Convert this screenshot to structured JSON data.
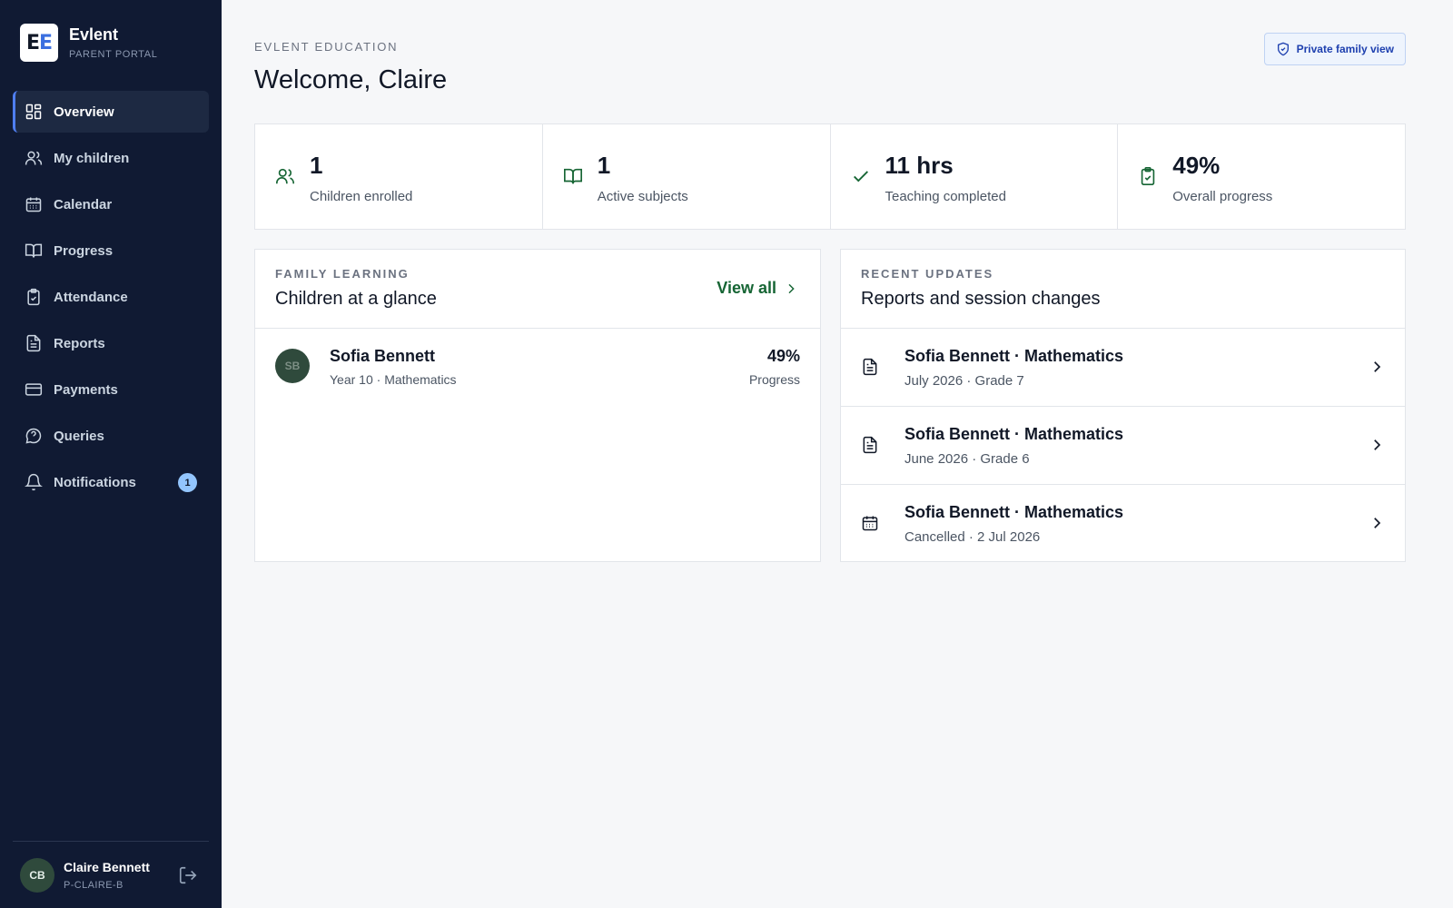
{
  "brand": {
    "logo_left": "E",
    "logo_right": "E",
    "name": "Evlent",
    "subtitle": "PARENT PORTAL"
  },
  "nav": {
    "items": [
      {
        "label": "Overview",
        "icon": "grid-icon",
        "active": true
      },
      {
        "label": "My children",
        "icon": "users-icon"
      },
      {
        "label": "Calendar",
        "icon": "calendar-icon"
      },
      {
        "label": "Progress",
        "icon": "book-icon"
      },
      {
        "label": "Attendance",
        "icon": "clipboard-check-icon"
      },
      {
        "label": "Reports",
        "icon": "document-icon"
      },
      {
        "label": "Payments",
        "icon": "credit-card-icon"
      },
      {
        "label": "Queries",
        "icon": "help-circle-icon"
      },
      {
        "label": "Notifications",
        "icon": "bell-icon",
        "badge": "1"
      }
    ]
  },
  "user": {
    "initials": "CB",
    "name": "Claire Bennett",
    "id": "P-CLAIRE-B"
  },
  "header": {
    "kicker": "EVLENT EDUCATION",
    "title": "Welcome, Claire",
    "private_label": "Private family view"
  },
  "stats": [
    {
      "value": "1",
      "label": "Children enrolled",
      "icon": "users-icon"
    },
    {
      "value": "1",
      "label": "Active subjects",
      "icon": "book-icon"
    },
    {
      "value": "11 hrs",
      "label": "Teaching completed",
      "icon": "check-icon"
    },
    {
      "value": "49%",
      "label": "Overall progress",
      "icon": "clipboard-check-icon"
    }
  ],
  "family": {
    "kicker": "FAMILY LEARNING",
    "title": "Children at a glance",
    "view_all": "View all",
    "children": [
      {
        "initials": "SB",
        "name": "Sofia Bennett",
        "detail": "Year 10 · Mathematics",
        "progress": "49%",
        "progress_label": "Progress"
      }
    ]
  },
  "updates": {
    "kicker": "RECENT UPDATES",
    "title": "Reports and session changes",
    "items": [
      {
        "title": "Sofia Bennett · Mathematics",
        "detail": "July 2026 · Grade 7",
        "icon": "document-icon"
      },
      {
        "title": "Sofia Bennett · Mathematics",
        "detail": "June 2026 · Grade 6",
        "icon": "document-icon"
      },
      {
        "title": "Sofia Bennett · Mathematics",
        "detail": "Cancelled · 2 Jul 2026",
        "icon": "calendar-icon"
      }
    ]
  },
  "colors": {
    "sidebar_bg": "#101a33",
    "accent_blue": "#4f7ef0",
    "accent_green": "#166534",
    "badge": "#93c5fd"
  }
}
